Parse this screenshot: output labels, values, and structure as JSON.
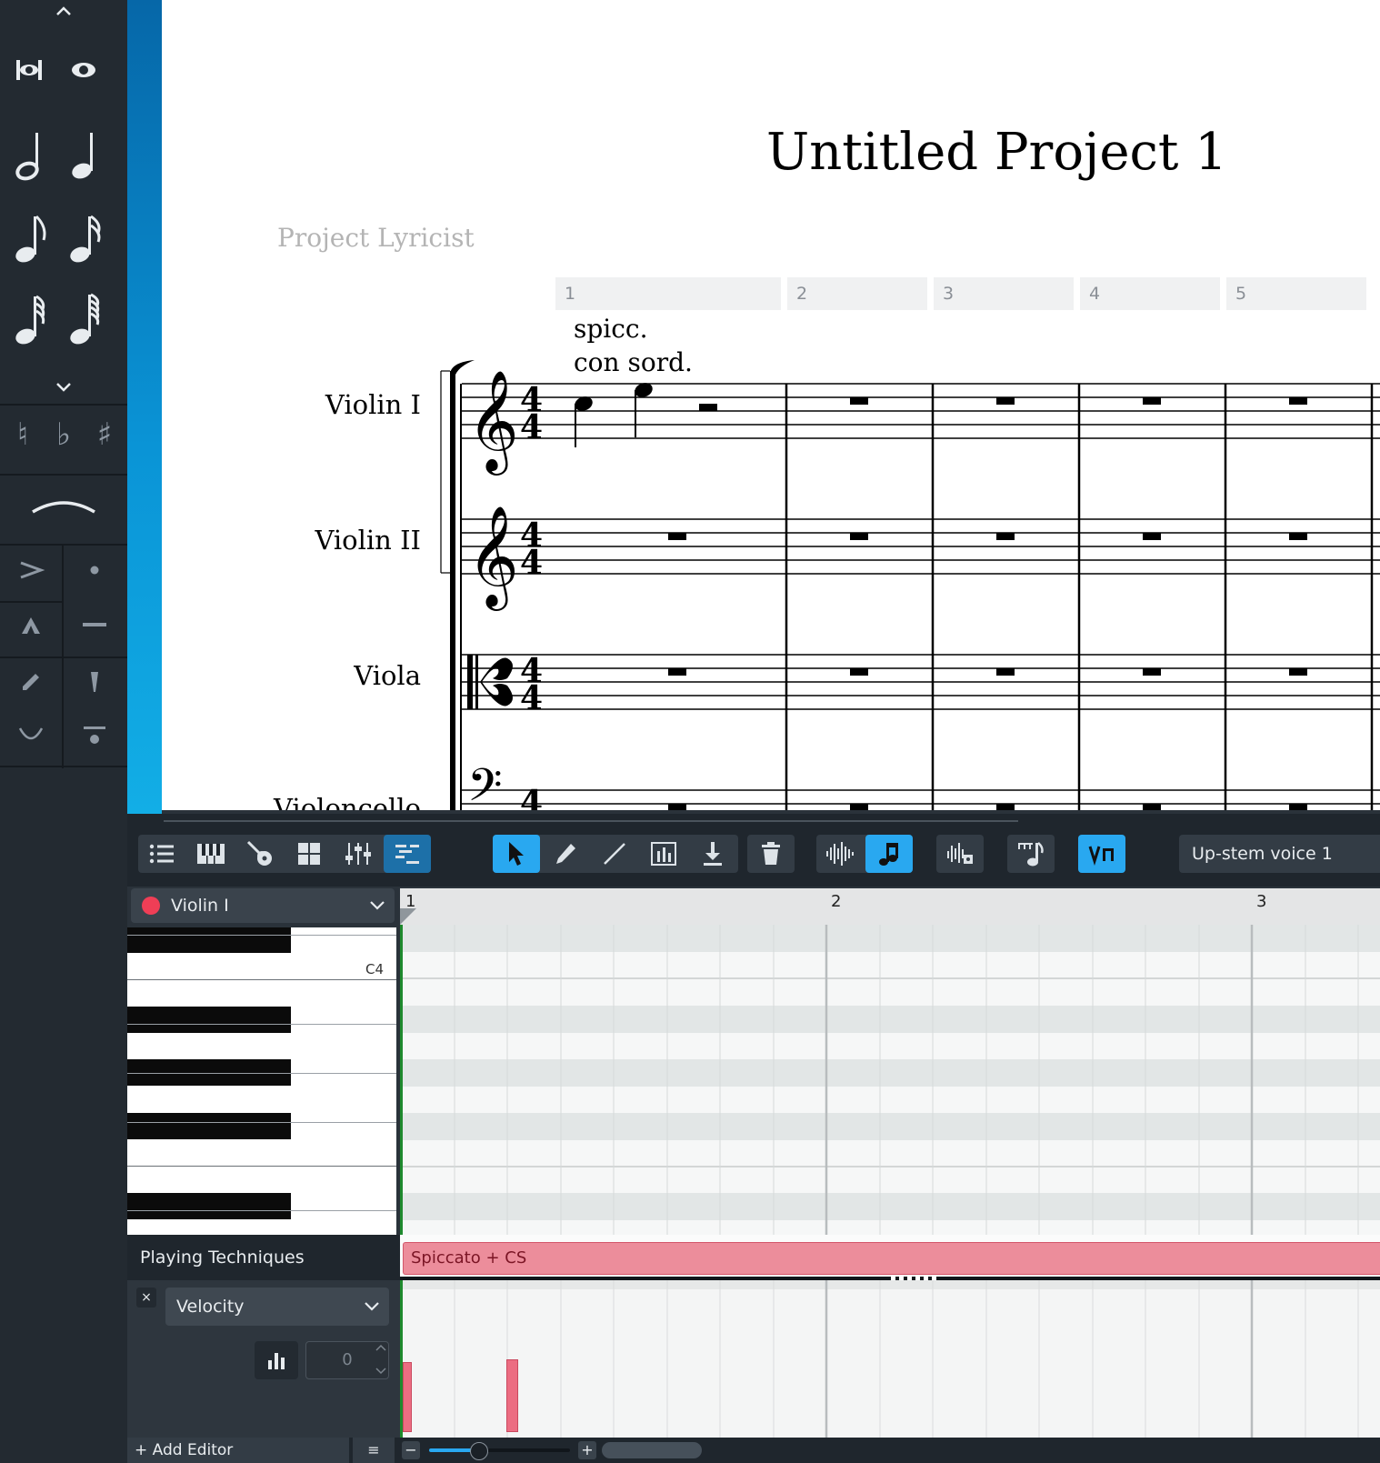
{
  "palette": {
    "icons": [
      "chevron-up-icon",
      "double-whole-note-icon",
      "whole-note-icon",
      "half-note-icon",
      "quarter-note-icon",
      "eighth-note-icon",
      "sixteenth-note-icon",
      "thirty-second-note-icon",
      "sixty-fourth-note-icon",
      "chevron-down-icon",
      "natural-icon",
      "flat-icon",
      "sharp-icon",
      "slur-icon",
      "accent-icon",
      "staccato-icon",
      "marcato-icon",
      "tenuto-icon",
      "staccatissimo-icon",
      "wedge-icon",
      "up-bow-icon",
      "stress-icon"
    ]
  },
  "score": {
    "title": "Untitled Project 1",
    "lyricist": "Project Lyricist",
    "bar_numbers": [
      "1",
      "2",
      "3",
      "4",
      "5"
    ],
    "techniques": [
      "spicc.",
      "con sord."
    ],
    "instruments": [
      "Violin I",
      "Violin II",
      "Viola",
      "Violoncello"
    ],
    "time_signature": "4/4"
  },
  "lower_zone": {
    "toolbar": {
      "left_icons": [
        "list-icon",
        "piano-icon",
        "guitar-icon",
        "grid-icon",
        "mixer-icon",
        "key-editor-icon"
      ],
      "tools": [
        "select-arrow-icon",
        "pencil-icon",
        "line-icon",
        "velocity-box-icon",
        "insert-icon"
      ],
      "delete_icon": "trash-icon",
      "playback_icons": [
        "waveform-icon",
        "note-icon"
      ],
      "other_icons": [
        "dynamics-icon",
        "rhythm-icon",
        "voice-icon"
      ],
      "voice": "Up-stem voice 1"
    },
    "track": {
      "name": "Violin I",
      "color": "#ef3e56"
    },
    "piano": {
      "c4_label": "C4"
    },
    "ruler": [
      "1",
      "2",
      "3"
    ],
    "playing_techniques": {
      "label": "Playing Techniques",
      "segment": "Spiccato + CS",
      "color": "#ec8d9b"
    },
    "velocity": {
      "close": "×",
      "lane": "Velocity",
      "value": "0",
      "bars": [
        0.48,
        0.5
      ]
    },
    "bottom": {
      "add_editor": "+ Add Editor",
      "menu": "≡",
      "zoom_minus": "−",
      "zoom_plus": "+",
      "zoom_level": 0.35
    }
  },
  "colors": {
    "accent": "#29a8f0",
    "panel": "#232a31",
    "technique": "#ec8d9b"
  }
}
